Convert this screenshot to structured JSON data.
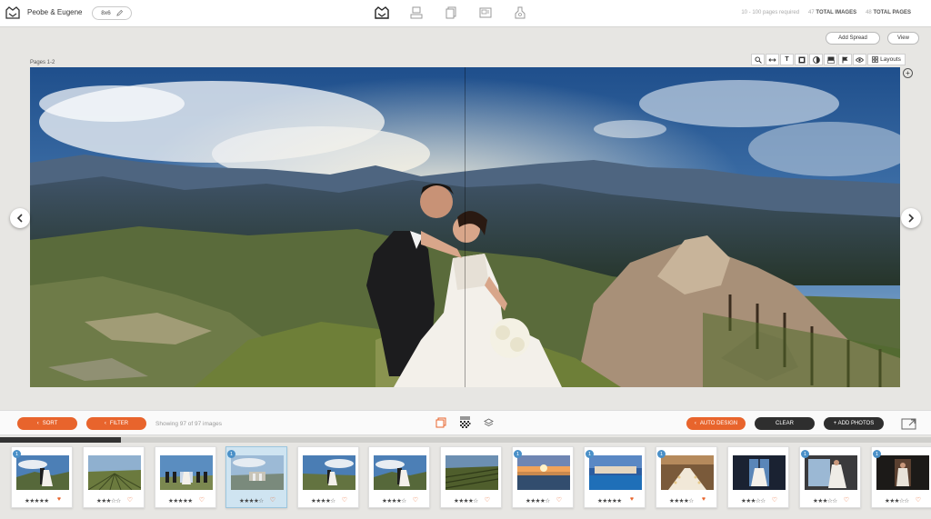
{
  "header": {
    "album_title": "Peobe & Eugene",
    "size_label": "8x6",
    "nav_icons": [
      "spreads-icon",
      "layout-icon",
      "pages-icon",
      "photos-icon",
      "settings-icon"
    ],
    "pages_required": "10 - 100 pages required",
    "total_images_count": "47",
    "total_images_label": "TOTAL IMAGES",
    "total_pages_count": "48",
    "total_pages_label": "TOTAL PAGES"
  },
  "actions": {
    "add_spread": "Add Spread",
    "view": "View"
  },
  "spread": {
    "page_label": "Pages 1-2",
    "layouts_label": "Layouts"
  },
  "bottom": {
    "sort": "SORT",
    "filter": "FILTER",
    "showing": "Showing 97 of 97 images",
    "auto_design": "AUTO DESIGN",
    "clear": "CLEAR",
    "add_photos": "+ ADD PHOTOS",
    "scroll_progress": 0.13
  },
  "colors": {
    "accent": "#e8642c",
    "dark": "#2e2e2e",
    "badge": "#4a90c8"
  },
  "thumbnails": [
    {
      "badge": "1",
      "stars": "★★★★★",
      "heart": "♥",
      "scene": "couple-sky"
    },
    {
      "badge": "",
      "stars": "★★★☆☆",
      "heart": "♡",
      "scene": "vineyard"
    },
    {
      "badge": "",
      "stars": "★★★★★",
      "heart": "♡",
      "scene": "group"
    },
    {
      "badge": "1",
      "stars": "★★★★☆",
      "heart": "♡",
      "scene": "venue",
      "selected": true
    },
    {
      "badge": "",
      "stars": "★★★★☆",
      "heart": "♡",
      "scene": "couple-field"
    },
    {
      "badge": "",
      "stars": "★★★★☆",
      "heart": "♡",
      "scene": "couple-sky"
    },
    {
      "badge": "",
      "stars": "★★★★☆",
      "heart": "♡",
      "scene": "vineyard-dark"
    },
    {
      "badge": "1",
      "stars": "★★★★☆",
      "heart": "♡",
      "scene": "pool-sunset"
    },
    {
      "badge": "1",
      "stars": "★★★★★",
      "heart": "♥",
      "scene": "pool-blue"
    },
    {
      "badge": "1",
      "stars": "★★★★☆",
      "heart": "♥",
      "scene": "dining"
    },
    {
      "badge": "",
      "stars": "★★★☆☆",
      "heart": "♡",
      "scene": "window"
    },
    {
      "badge": "1",
      "stars": "★★★☆☆",
      "heart": "♡",
      "scene": "bride-window"
    },
    {
      "badge": "1",
      "stars": "★★★☆☆",
      "heart": "♡",
      "scene": "portrait"
    }
  ]
}
